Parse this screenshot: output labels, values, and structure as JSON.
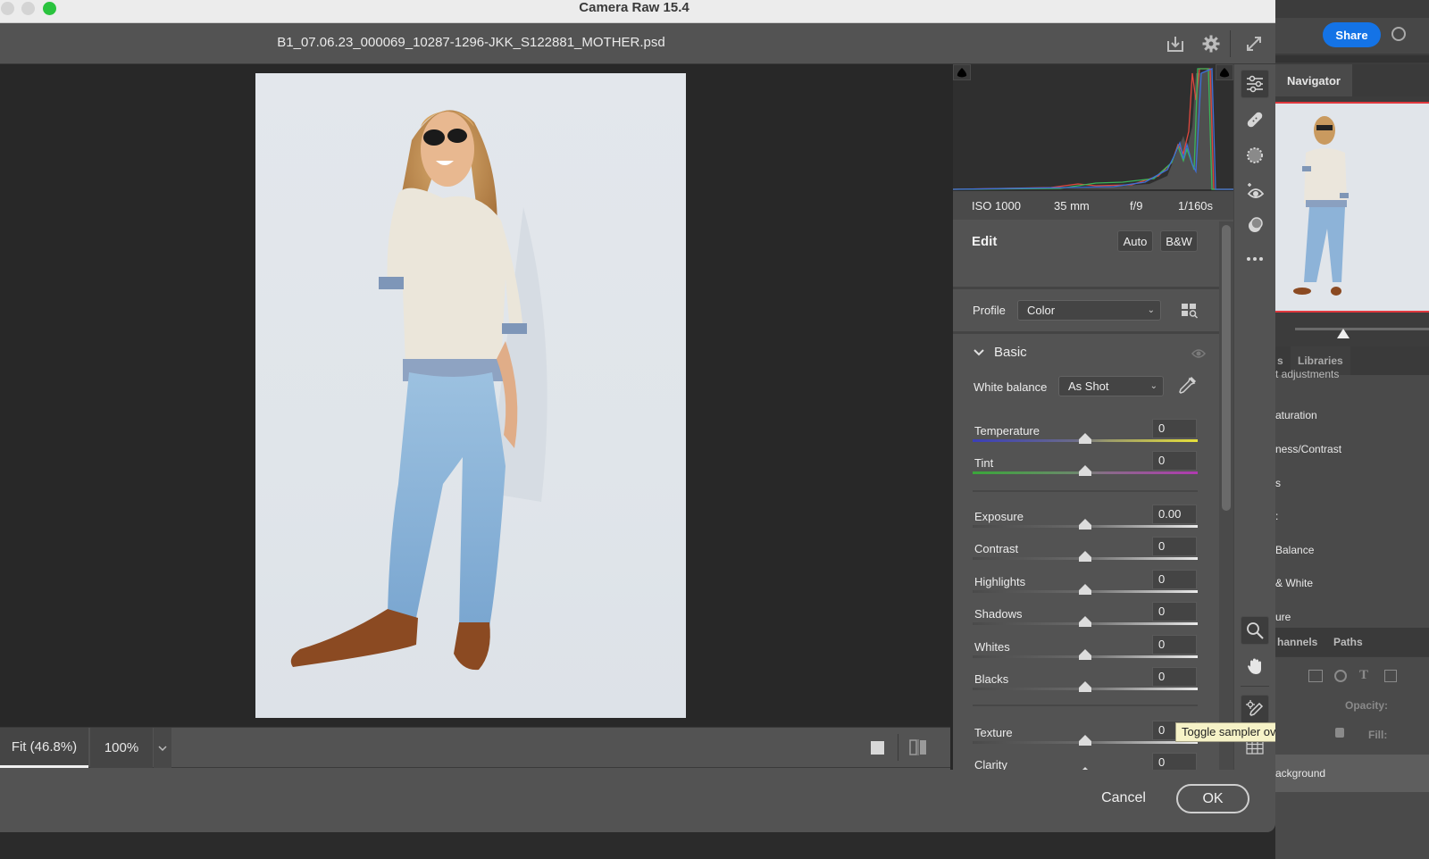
{
  "window": {
    "title": "Camera Raw 15.4",
    "filename": "B1_07.06.23_000069_10287-1296-JKK_S122881_MOTHER.psd",
    "header_icons": [
      "save-icon",
      "gear-icon",
      "fullscreen-icon"
    ]
  },
  "histogram": {
    "exif": {
      "iso": "ISO 1000",
      "focal_length": "35 mm",
      "aperture": "f/9",
      "shutter": "1/160s"
    }
  },
  "edit": {
    "title": "Edit",
    "auto_label": "Auto",
    "bw_label": "B&W",
    "profile_label": "Profile",
    "profile_value": "Color"
  },
  "basic": {
    "title": "Basic",
    "white_balance_label": "White balance",
    "white_balance_value": "As Shot",
    "sliders": [
      {
        "label": "Temperature",
        "value": "0",
        "position": 0.5
      },
      {
        "label": "Tint",
        "value": "0",
        "position": 0.5
      },
      {
        "label": "Exposure",
        "value": "0.00",
        "position": 0.5
      },
      {
        "label": "Contrast",
        "value": "0",
        "position": 0.5
      },
      {
        "label": "Highlights",
        "value": "0",
        "position": 0.5
      },
      {
        "label": "Shadows",
        "value": "0",
        "position": 0.5
      },
      {
        "label": "Whites",
        "value": "0",
        "position": 0.5
      },
      {
        "label": "Blacks",
        "value": "0",
        "position": 0.5
      },
      {
        "label": "Texture",
        "value": "0",
        "position": 0.5
      },
      {
        "label": "Clarity",
        "value": "0",
        "position": 0.5
      }
    ]
  },
  "zoom": {
    "fit_label": "Fit (46.8%)",
    "full_label": "100%"
  },
  "footer": {
    "cancel_label": "Cancel",
    "ok_label": "OK"
  },
  "tooltip": "Toggle sampler overlay (S)",
  "tools": [
    "edit-icon",
    "healing-icon",
    "masking-icon",
    "red-eye-icon",
    "presets-icon",
    "more-icon",
    "zoom-icon",
    "hand-icon",
    "color-sampler-icon",
    "grid-icon"
  ],
  "photoshop": {
    "share_label": "Share",
    "navigator_tab": "Navigator",
    "libraries_tab": "Libraries",
    "adjust_tab_partial": "s",
    "adjustment_items": [
      "t adjustments",
      "aturation",
      "ness/Contrast",
      "s",
      ":",
      "Balance",
      "& White",
      "ure"
    ],
    "channels_tab": "hannels",
    "paths_tab": "Paths",
    "opacity_label": "Opacity:",
    "fill_label": "Fill:",
    "layer_name": "ackground"
  },
  "colors": {
    "accent": "#1473e6",
    "traffic_green": "#2ac33e",
    "tooltip_bg": "#f6f2c7",
    "navigator_frame": "#e0383e"
  }
}
